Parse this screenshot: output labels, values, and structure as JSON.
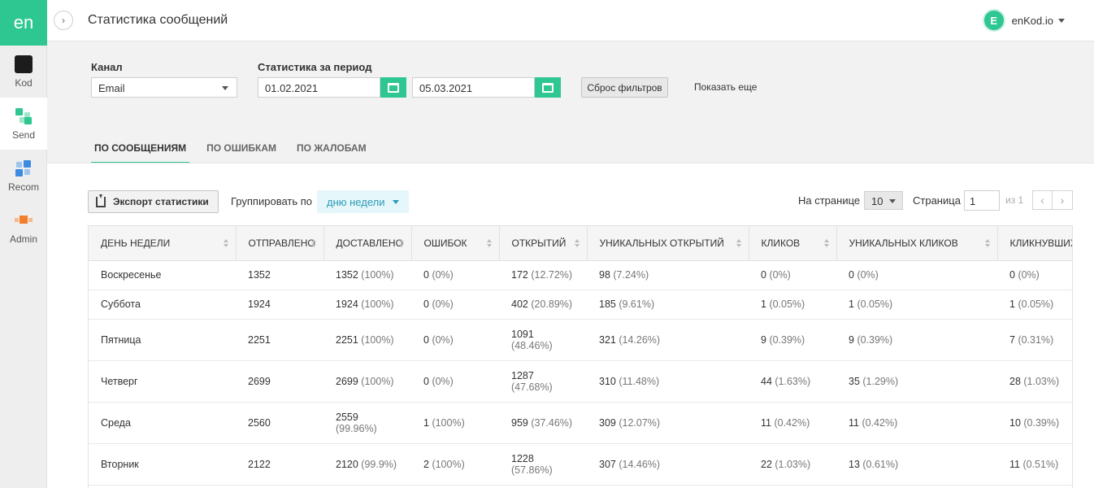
{
  "sidebar": {
    "logo": "en",
    "items": [
      {
        "label": "Kod",
        "icon": "kod-icon"
      },
      {
        "label": "Send",
        "icon": "send-icon"
      },
      {
        "label": "Recom",
        "icon": "recom-icon"
      },
      {
        "label": "Admin",
        "icon": "admin-icon"
      }
    ]
  },
  "header": {
    "title": "Статистика сообщений",
    "account_initial": "E",
    "account_name": "enKod.io"
  },
  "filters": {
    "channel_label": "Канал",
    "channel_value": "Email",
    "period_label": "Статистика за период",
    "date_from": "01.02.2021",
    "date_to": "05.03.2021",
    "reset_label": "Сброс фильтров",
    "show_more_label": "Показать еще"
  },
  "tabs": [
    "ПО СООБЩЕНИЯМ",
    "ПО ОШИБКАМ",
    "ПО ЖАЛОБАМ"
  ],
  "toolbar": {
    "export_label": "Экспорт статистики",
    "group_label": "Группировать по",
    "group_value": "дню недели",
    "per_page_label": "На странице",
    "per_page_value": "10",
    "page_label": "Страница",
    "page_value": "1",
    "page_of": "из 1"
  },
  "table": {
    "columns": [
      "ДЕНЬ НЕДЕЛИ",
      "ОТПРАВЛЕНО",
      "ДОСТАВЛЕНО",
      "ОШИБОК",
      "ОТКРЫТИЙ",
      "УНИКАЛЬНЫХ ОТКРЫТИЙ",
      "КЛИКОВ",
      "УНИКАЛЬНЫХ КЛИКОВ",
      "КЛИКНУВШИХ"
    ],
    "rows": [
      {
        "day": "Воскресенье",
        "sent": "1352",
        "delivered": {
          "v": "1352",
          "p": "(100%)"
        },
        "errors": {
          "v": "0",
          "p": "(0%)"
        },
        "opens": {
          "v": "172",
          "p": "(12.72%)"
        },
        "unique_opens": {
          "v": "98",
          "p": "(7.24%)"
        },
        "clicks": {
          "v": "0",
          "p": "(0%)"
        },
        "unique_clicks": {
          "v": "0",
          "p": "(0%)"
        },
        "clickers": {
          "v": "0",
          "p": "(0%)"
        }
      },
      {
        "day": "Суббота",
        "sent": "1924",
        "delivered": {
          "v": "1924",
          "p": "(100%)"
        },
        "errors": {
          "v": "0",
          "p": "(0%)"
        },
        "opens": {
          "v": "402",
          "p": "(20.89%)"
        },
        "unique_opens": {
          "v": "185",
          "p": "(9.61%)"
        },
        "clicks": {
          "v": "1",
          "p": "(0.05%)"
        },
        "unique_clicks": {
          "v": "1",
          "p": "(0.05%)"
        },
        "clickers": {
          "v": "1",
          "p": "(0.05%)"
        }
      },
      {
        "day": "Пятница",
        "sent": "2251",
        "delivered": {
          "v": "2251",
          "p": "(100%)"
        },
        "errors": {
          "v": "0",
          "p": "(0%)"
        },
        "opens": {
          "v": "1091",
          "p": "(48.46%)"
        },
        "unique_opens": {
          "v": "321",
          "p": "(14.26%)"
        },
        "clicks": {
          "v": "9",
          "p": "(0.39%)"
        },
        "unique_clicks": {
          "v": "9",
          "p": "(0.39%)"
        },
        "clickers": {
          "v": "7",
          "p": "(0.31%)"
        }
      },
      {
        "day": "Четверг",
        "sent": "2699",
        "delivered": {
          "v": "2699",
          "p": "(100%)"
        },
        "errors": {
          "v": "0",
          "p": "(0%)"
        },
        "opens": {
          "v": "1287",
          "p": "(47.68%)"
        },
        "unique_opens": {
          "v": "310",
          "p": "(11.48%)"
        },
        "clicks": {
          "v": "44",
          "p": "(1.63%)"
        },
        "unique_clicks": {
          "v": "35",
          "p": "(1.29%)"
        },
        "clickers": {
          "v": "28",
          "p": "(1.03%)"
        }
      },
      {
        "day": "Среда",
        "sent": "2560",
        "delivered": {
          "v": "2559",
          "p": "(99.96%)"
        },
        "errors": {
          "v": "1",
          "p": "(100%)"
        },
        "opens": {
          "v": "959",
          "p": "(37.46%)"
        },
        "unique_opens": {
          "v": "309",
          "p": "(12.07%)"
        },
        "clicks": {
          "v": "11",
          "p": "(0.42%)"
        },
        "unique_clicks": {
          "v": "11",
          "p": "(0.42%)"
        },
        "clickers": {
          "v": "10",
          "p": "(0.39%)"
        }
      },
      {
        "day": "Вторник",
        "sent": "2122",
        "delivered": {
          "v": "2120",
          "p": "(99.9%)"
        },
        "errors": {
          "v": "2",
          "p": "(100%)"
        },
        "opens": {
          "v": "1228",
          "p": "(57.86%)"
        },
        "unique_opens": {
          "v": "307",
          "p": "(14.46%)"
        },
        "clicks": {
          "v": "22",
          "p": "(1.03%)"
        },
        "unique_clicks": {
          "v": "13",
          "p": "(0.61%)"
        },
        "clickers": {
          "v": "11",
          "p": "(0.51%)"
        }
      }
    ]
  }
}
